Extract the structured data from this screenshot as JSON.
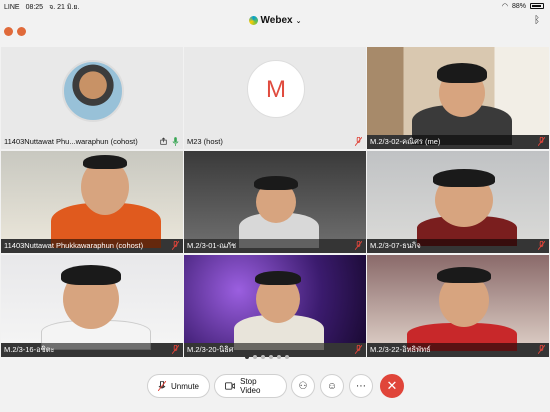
{
  "status": {
    "carrier": "LINE",
    "time": "08:25",
    "date": "จ. 21 มิ.ย.",
    "battery": "88%"
  },
  "header": {
    "title": "Webex"
  },
  "tiles": [
    {
      "name": "11403Nuttawat Phu...waraphun (cohost)"
    },
    {
      "name": "M23 (host)",
      "avatar_letter": "M"
    },
    {
      "name": "M.2/3-02-คณิศร (me)"
    },
    {
      "name": "11403Nuttawat Phukkawaraphun (cohost)"
    },
    {
      "name": "M.2/3-01-ณภัช"
    },
    {
      "name": "M.2/3-07-ธนกิจ"
    },
    {
      "name": "M.2/3-16-อชิตะ"
    },
    {
      "name": "M.2/3-20-นิธิศ"
    },
    {
      "name": "M.2/3-22-อิทธิพัทธ์"
    }
  ],
  "controls": {
    "unmute_label": "Unmute",
    "stop_video_label": "Stop Video"
  },
  "colors": {
    "accent": "#2d8fd5",
    "end_call": "#e0453a",
    "muted": "#e0453a"
  }
}
